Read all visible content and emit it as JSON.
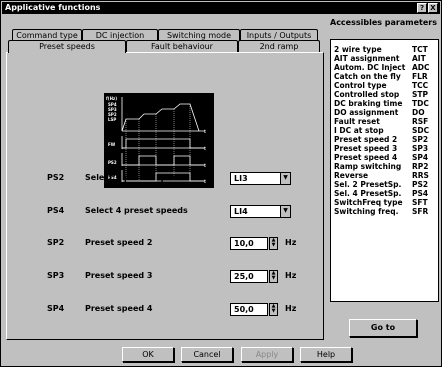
{
  "window": {
    "title": "Applicative functions",
    "help": "?",
    "close": "X"
  },
  "tabs": {
    "row1": [
      "Command type",
      "DC injection",
      "Switching mode",
      "Inputs / Outputs"
    ],
    "row2": [
      "Preset speeds",
      "Fault behaviour",
      "2nd ramp"
    ],
    "active": "Preset speeds"
  },
  "diagram": {
    "y_labels": [
      "f(Hz)",
      "SP4",
      "SP3",
      "SP2",
      "LSP"
    ],
    "trace_labels": [
      "FW",
      "PS2",
      "PS4"
    ],
    "time_label": "t"
  },
  "settings": [
    {
      "code": "PS2",
      "label": "Select 2 preset speeds",
      "value": "LI3",
      "type": "combo"
    },
    {
      "code": "PS4",
      "label": "Select 4 preset speeds",
      "value": "LI4",
      "type": "combo"
    },
    {
      "code": "SP2",
      "label": "Preset speed 2",
      "value": "10,0",
      "unit": "Hz",
      "type": "number"
    },
    {
      "code": "SP3",
      "label": "Preset speed 3",
      "value": "25,0",
      "unit": "Hz",
      "type": "number"
    },
    {
      "code": "SP4",
      "label": "Preset speed 4",
      "value": "50,0",
      "unit": "Hz",
      "type": "number"
    }
  ],
  "buttons": {
    "ok": "OK",
    "cancel": "Cancel",
    "apply": "Apply",
    "help": "Help"
  },
  "side": {
    "title": "Accessibles parameters",
    "goto": "Go to",
    "items": [
      {
        "name": "2 wire type",
        "code": "TCT"
      },
      {
        "name": "AIT assignment",
        "code": "AIT"
      },
      {
        "name": "Autom. DC Inject",
        "code": "ADC"
      },
      {
        "name": "Catch on the fly",
        "code": "FLR"
      },
      {
        "name": "Control type",
        "code": "TCC"
      },
      {
        "name": "Controlled stop",
        "code": "STP"
      },
      {
        "name": "DC braking time",
        "code": "TDC"
      },
      {
        "name": "DO assignment",
        "code": "DO"
      },
      {
        "name": "Fault reset",
        "code": "RSF"
      },
      {
        "name": "I DC at stop",
        "code": "SDC"
      },
      {
        "name": "Preset speed 2",
        "code": "SP2"
      },
      {
        "name": "Preset speed 3",
        "code": "SP3"
      },
      {
        "name": "Preset speed 4",
        "code": "SP4"
      },
      {
        "name": "Ramp switching",
        "code": "RP2"
      },
      {
        "name": "Reverse",
        "code": "RRS"
      },
      {
        "name": "Sel. 2 PresetSp.",
        "code": "PS2"
      },
      {
        "name": "Sel. 4 PresetSp.",
        "code": "PS4"
      },
      {
        "name": "SwitchFreq type",
        "code": "SFT"
      },
      {
        "name": "Switching freq.",
        "code": "SFR"
      }
    ]
  }
}
